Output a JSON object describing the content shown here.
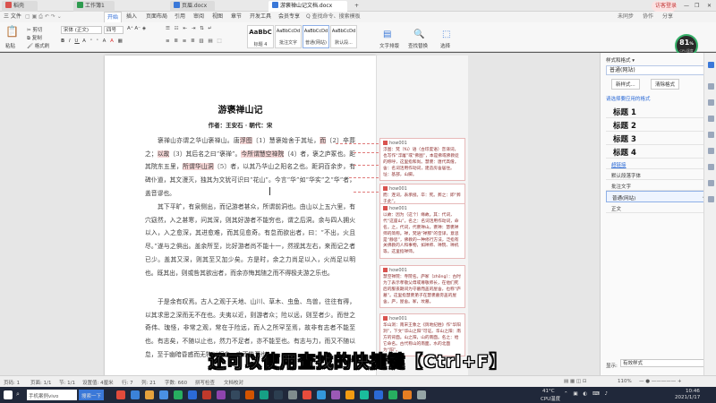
{
  "tabs": [
    {
      "label": "稻壳",
      "color": "#d9534f"
    },
    {
      "label": "工作簿1",
      "color": "#2e9b4f"
    },
    {
      "label": "页眉.docx",
      "color": "#3a78d8"
    },
    {
      "label": "游褒禅山记文档.docx",
      "color": "#3a78d8"
    }
  ],
  "window": {
    "user_badge": "访客登录",
    "minimize": "—",
    "maximize": "❐",
    "close": "✕"
  },
  "menu": {
    "file": "三 文件",
    "items": [
      "开始",
      "插入",
      "页面布局",
      "引用",
      "审阅",
      "视图",
      "章节",
      "开发工具",
      "会员专享"
    ],
    "active_index": 0,
    "search": "Q 查找命令、搜索模板",
    "right": [
      "未同步",
      "协作",
      "分享"
    ]
  },
  "ribbon": {
    "paste": "粘贴",
    "cut": "剪切",
    "copy": "复制",
    "format_painter": "格式刷",
    "font_name": "宋体 (正文)",
    "font_size": "四号",
    "styles": [
      {
        "sample": "AaBbC",
        "name": "标题 4"
      },
      {
        "sample": "AaBbCcDd",
        "name": "批注文字"
      },
      {
        "sample": "AaBbCcDd",
        "name": "普通(网站)"
      },
      {
        "sample": "AaBbCcDd",
        "name": "默认段..."
      }
    ],
    "text_tools": "文字排版",
    "find_replace": "查找替换",
    "select": "选择"
  },
  "document": {
    "title": "游褒禅山记",
    "author": "作者：王安石 · 朝代：宋",
    "paragraphs": [
      [
        "褒禅山亦谓之华山褒禅山。唐",
        "浮图",
        "〔1〕慧褒始舍于其址，",
        "而",
        "〔2〕卒葬之；",
        "以故",
        "〔3〕其后名之曰“褒禅”。",
        "今所谓慧空禅院",
        "〔4〕者，褒之庐冢也。距其院东五里，",
        "所谓华山洞",
        "〔5〕者，以其乃华山之阳名之也。距洞百余步，有碑仆道，其文漫灭，独其为文犹可识曰“花山”。今言“华”如“华实”之“华”者，盖音谬也。"
      ],
      "其下平旷，有泉侧出，而记游者甚众，所谓前洞也。由山以上五六里，有穴窈然，入之甚寒，问其深，则其好游者不能穷也，谓之后洞。余与四人拥火以入，入之愈深，其进愈难，而其见愈奇。有怠而欲出者，曰：“不出，火且尽。”遂与之俱出。盖余所至，比好游者尚不能十一，然视其左右，来而记之者已少。盖其又深，则其至又加少矣。方是时，余之力尚足以入，火尚足以明也。既其出，则或咎其欲出者，而余亦悔其随之而不得极夫游之乐也。",
      "于是余有叹焉。古人之观于天地、山川、草木、虫鱼、鸟兽，往往有得，以其求思之深而无不在也。夫夷以近，则游者众；险以远，则至者少。而世之奇伟、瑰怪，非常之观，常在于险远，而人之所罕至焉，故非有志者不能至也。有志矣，不随以止也，然力不足者，亦不能至也。有志与力，而又不随以怠，至于幽暗昏惑而无物以相之，亦不能至也。"
    ]
  },
  "comments": [
    {
      "author": "how001",
      "text": "浮图：梵（fú）语（古印度语）音译词，也写作“浮屠”或“佛图”，本是佛或佛教徒的称呼，这里指和尚。慧褒：唐代高僧。舍：名词活用作动词，建造房舍居住。址：基部，山脚。"
    },
    {
      "author": "how001",
      "text": "而：连词，表承接。卒：死。葬之：即“葬于此”。"
    },
    {
      "author": "how001",
      "text": "以故：因为（这个）缘故。其：代词，代“这座山”。名之：名词活用作动词，命名。之，代词，代褒禅山。褒禅：慧褒禅师的简称。禅，梵语“禅那”的音译，意思是“静思”，佛教的一种修行方法，泛指有关佛教的人和事物，如禅师、禅院、禅机等。这里指禅师。"
    },
    {
      "author": "how001",
      "text": "慧空禅院：寺院名。庐冢（zhǒng）：古时为了表示孝敬父母或尊敬师长，在他们死后的服丧期间为守墓而盖的屋舍，也称“庐墓”。这里指慧褒弟子在慧褒墓旁盖的屋舍。庐，屋舍。冢，坟墓。"
    },
    {
      "author": "how001",
      "text": "华山洞：南宋王象之《舆地纪胜》作“华阳洞”，下文“华山之阳”可证。华山之阳：南方的背面。山之阳，山的南面。名之：给它命名。古代称山的南面，水的北面为“阳”。"
    }
  ],
  "styles_pane": {
    "header": "样式和格式 ▾",
    "current": "普通(网站)",
    "new_style": "新样式...",
    "clear_format": "清除格式",
    "apply_label": "请选择要应用的格式",
    "headings": [
      "标题 1",
      "标题 2",
      "标题 3",
      "标题 4"
    ],
    "others": [
      "超链接",
      "默认段落字体",
      "批注文字",
      "普通(网站)",
      "正文"
    ],
    "show_label": "显示:",
    "show_value": "有效样式"
  },
  "subtitle": "还可以使用查找的快捷键【Ctrl+F】",
  "status": {
    "page": "页码: 1",
    "pages": "页面: 1/1",
    "section": "节: 1/1",
    "position": "设置值: 4厘米",
    "line": "行: 7",
    "column": "列: 21",
    "words": "字数: 660",
    "spell": "拼写检查",
    "doc_check": "文档校对",
    "zoom": "110%"
  },
  "cpu": {
    "value": "81",
    "unit": "%",
    "label": "CPU温度"
  },
  "taskbar": {
    "start_search": "手机案例vivo",
    "search_btn": "搜索一下",
    "temp": "41°C",
    "temp_label": "CPU温度",
    "time": "10:46",
    "date": "2021/1/17"
  },
  "colors": {
    "accent": "#2b6ad6",
    "comment_border": "#e7b9b9",
    "highlight": "#f6d6d6",
    "comment_marker": "#d9534f"
  }
}
